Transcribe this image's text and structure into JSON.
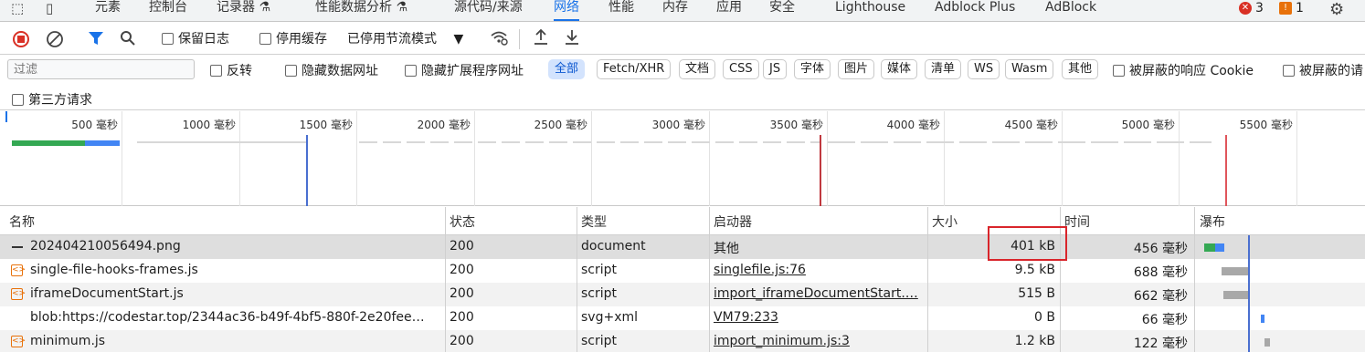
{
  "tabs": [
    "元素",
    "控制台",
    "记录器",
    "性能数据分析",
    "源代码/来源",
    "网络",
    "性能",
    "内存",
    "应用",
    "安全",
    "Lighthouse",
    "Adblock Plus",
    "AdBlock"
  ],
  "badges": {
    "errors": "3",
    "warnings": "1"
  },
  "toolbar": {
    "preserve_log": "保留日志",
    "disable_cache": "停用缓存",
    "throttle": "已停用节流模式"
  },
  "filter": {
    "placeholder": "过滤",
    "invert": "反转",
    "hide_data_urls": "隐藏数据网址",
    "hide_ext_urls": "隐藏扩展程序网址",
    "types": [
      "全部",
      "Fetch/XHR",
      "文档",
      "CSS",
      "JS",
      "字体",
      "图片",
      "媒体",
      "清单",
      "WS",
      "Wasm",
      "其他"
    ],
    "blocked_cookies": "被屏蔽的响应 Cookie",
    "blocked_requests": "被屏蔽的请",
    "third_party": "第三方请求"
  },
  "overview": {
    "ticks": [
      "500 毫秒",
      "1000 毫秒",
      "1500 毫秒",
      "2000 毫秒",
      "2500 毫秒",
      "3000 毫秒",
      "3500 毫秒",
      "4000 毫秒",
      "4500 毫秒",
      "5000 毫秒",
      "5500 毫秒"
    ]
  },
  "columns": {
    "name": "名称",
    "status": "状态",
    "type": "类型",
    "initiator": "启动器",
    "size": "大小",
    "time": "时间",
    "waterfall": "瀑布"
  },
  "rows": [
    {
      "name": "202404210056494.png",
      "status": "200",
      "type": "document",
      "initiator": "其他",
      "size": "401 kB",
      "time": "456 毫秒"
    },
    {
      "name": "single-file-hooks-frames.js",
      "status": "200",
      "type": "script",
      "initiator": "singlefile.js:76",
      "size": "9.5 kB",
      "time": "688 毫秒"
    },
    {
      "name": "iframeDocumentStart.js",
      "status": "200",
      "type": "script",
      "initiator": "import_iframeDocumentStart.…",
      "size": "515 B",
      "time": "662 毫秒"
    },
    {
      "name": "blob:https://codestar.top/2344ac36-b49f-4bf5-880f-2e20fee…",
      "status": "200",
      "type": "svg+xml",
      "initiator": "VM79:233",
      "size": "0 B",
      "time": "66 毫秒"
    },
    {
      "name": "minimum.js",
      "status": "200",
      "type": "script",
      "initiator": "import_minimum.js:3",
      "size": "1.2 kB",
      "time": "122 毫秒"
    }
  ],
  "colors": {
    "accent": "#1a73e8",
    "highlight": "#d9252b",
    "error": "#d93025",
    "warning": "#e8710a"
  }
}
